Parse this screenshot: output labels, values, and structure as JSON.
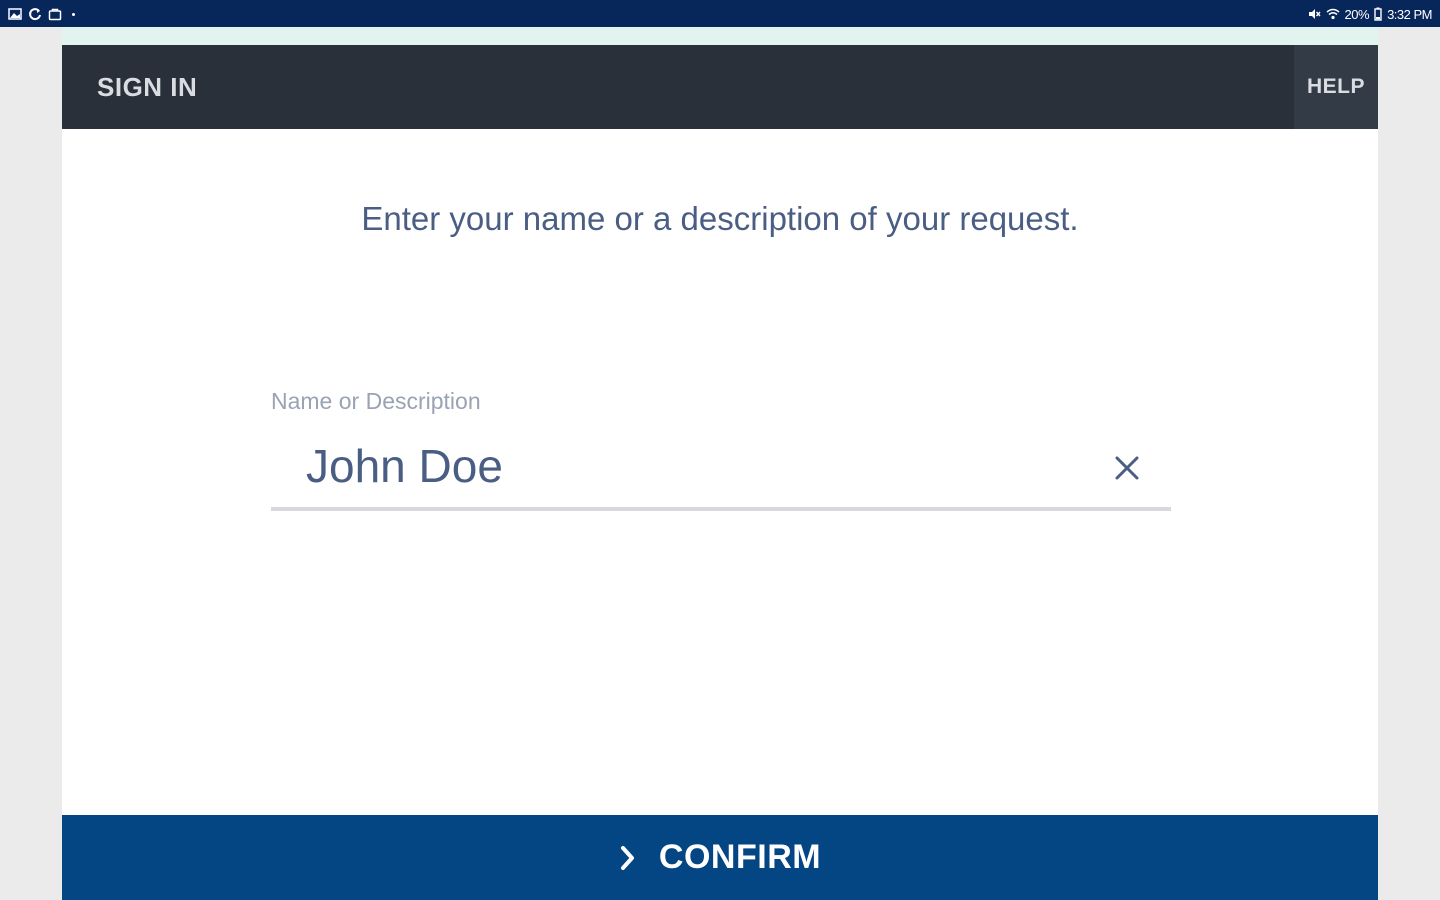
{
  "status_bar": {
    "left_icons": [
      "gallery-icon",
      "sync-icon",
      "bag-icon"
    ],
    "right_icons": [
      "mute-icon",
      "wifi-icon"
    ],
    "battery": "20%",
    "time": "3:32 PM"
  },
  "header": {
    "title": "SIGN IN",
    "help_label": "HELP"
  },
  "main": {
    "instruction": "Enter your name or a description of your request.",
    "field": {
      "label": "Name or Description",
      "value": "John Doe",
      "clear_icon": "close-icon"
    }
  },
  "footer": {
    "confirm_label": "CONFIRM",
    "confirm_icon": "chevron-right-icon"
  },
  "colors": {
    "status_bar": "#07265a",
    "header": "#293039",
    "primary": "#044584",
    "text": "#4a5e84",
    "label": "#9aa3b3"
  }
}
